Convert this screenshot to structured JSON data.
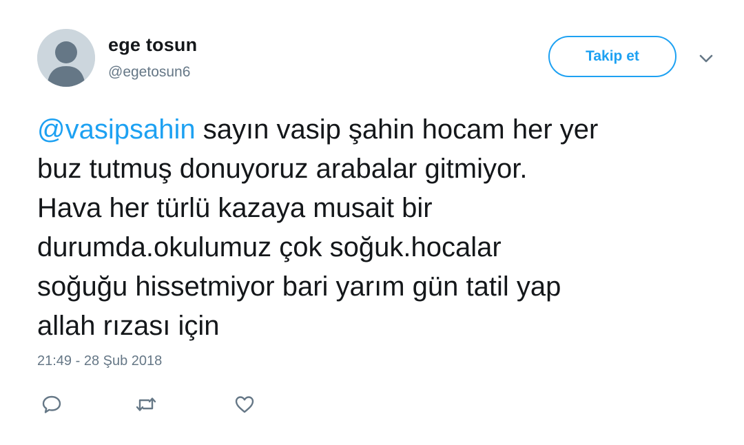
{
  "author": {
    "name": "ege tosun",
    "handle": "@egetosun6"
  },
  "follow_button": {
    "label": "Takip et"
  },
  "tweet": {
    "mention": "@vasipsahin",
    "lines": [
      " sayın vasip şahin hocam her yer",
      "buz tutmuş donuyoruz arabalar gitmiyor.",
      "Hava her türlü kazaya musait bir",
      "durumda.okulumuz çok soğuk.hocalar",
      "soğuğu hissetmiyor bari yarım gün tatil yap",
      "allah rızası için"
    ],
    "timestamp": "21:49 - 28 Şub 2018"
  },
  "actions": {
    "reply_icon": "speech-bubble-icon",
    "retweet_icon": "retweet-arrows-icon",
    "like_icon": "heart-icon"
  },
  "colors": {
    "accent": "#1da1f2",
    "text": "#14171a",
    "secondary": "#657786",
    "avatar_bg": "#ccd6dd",
    "avatar_fg": "#657786"
  }
}
